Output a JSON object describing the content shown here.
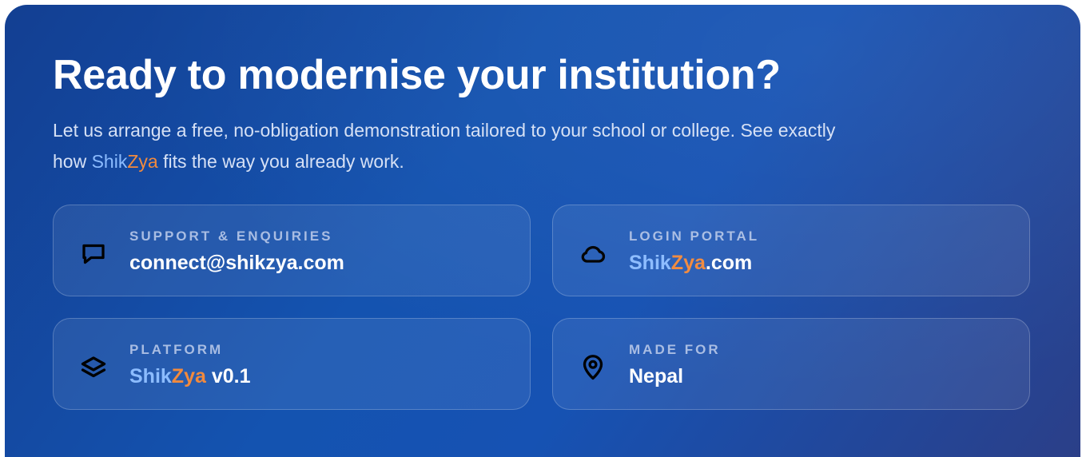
{
  "hero": {
    "title": "Ready to modernise your institution?",
    "lead_before": "Let us arrange a free, no-obligation demonstration tailored to your school or college. See exactly how ",
    "brand_a": "Shik",
    "brand_b": "Zya",
    "lead_after": " fits the way you already work."
  },
  "colors": {
    "brand_shik": "#8cbcff",
    "brand_zya": "#f28a3d",
    "background_from": "#133f92",
    "background_to": "#2b3f88"
  },
  "cards": [
    {
      "icon": "chat-bubble-icon",
      "label": "SUPPORT & ENQUIRIES",
      "value": "connect@shikzya.com"
    },
    {
      "icon": "cloud-icon",
      "label": "LOGIN PORTAL",
      "value_a": "Shik",
      "value_b": "Zya",
      "value_c": ".com"
    },
    {
      "icon": "layers-icon",
      "label": "PLATFORM",
      "value_a": "Shik",
      "value_b": "Zya",
      "value_c": " v0.1"
    },
    {
      "icon": "map-pin-icon",
      "label": "MADE FOR",
      "value": "Nepal"
    }
  ]
}
